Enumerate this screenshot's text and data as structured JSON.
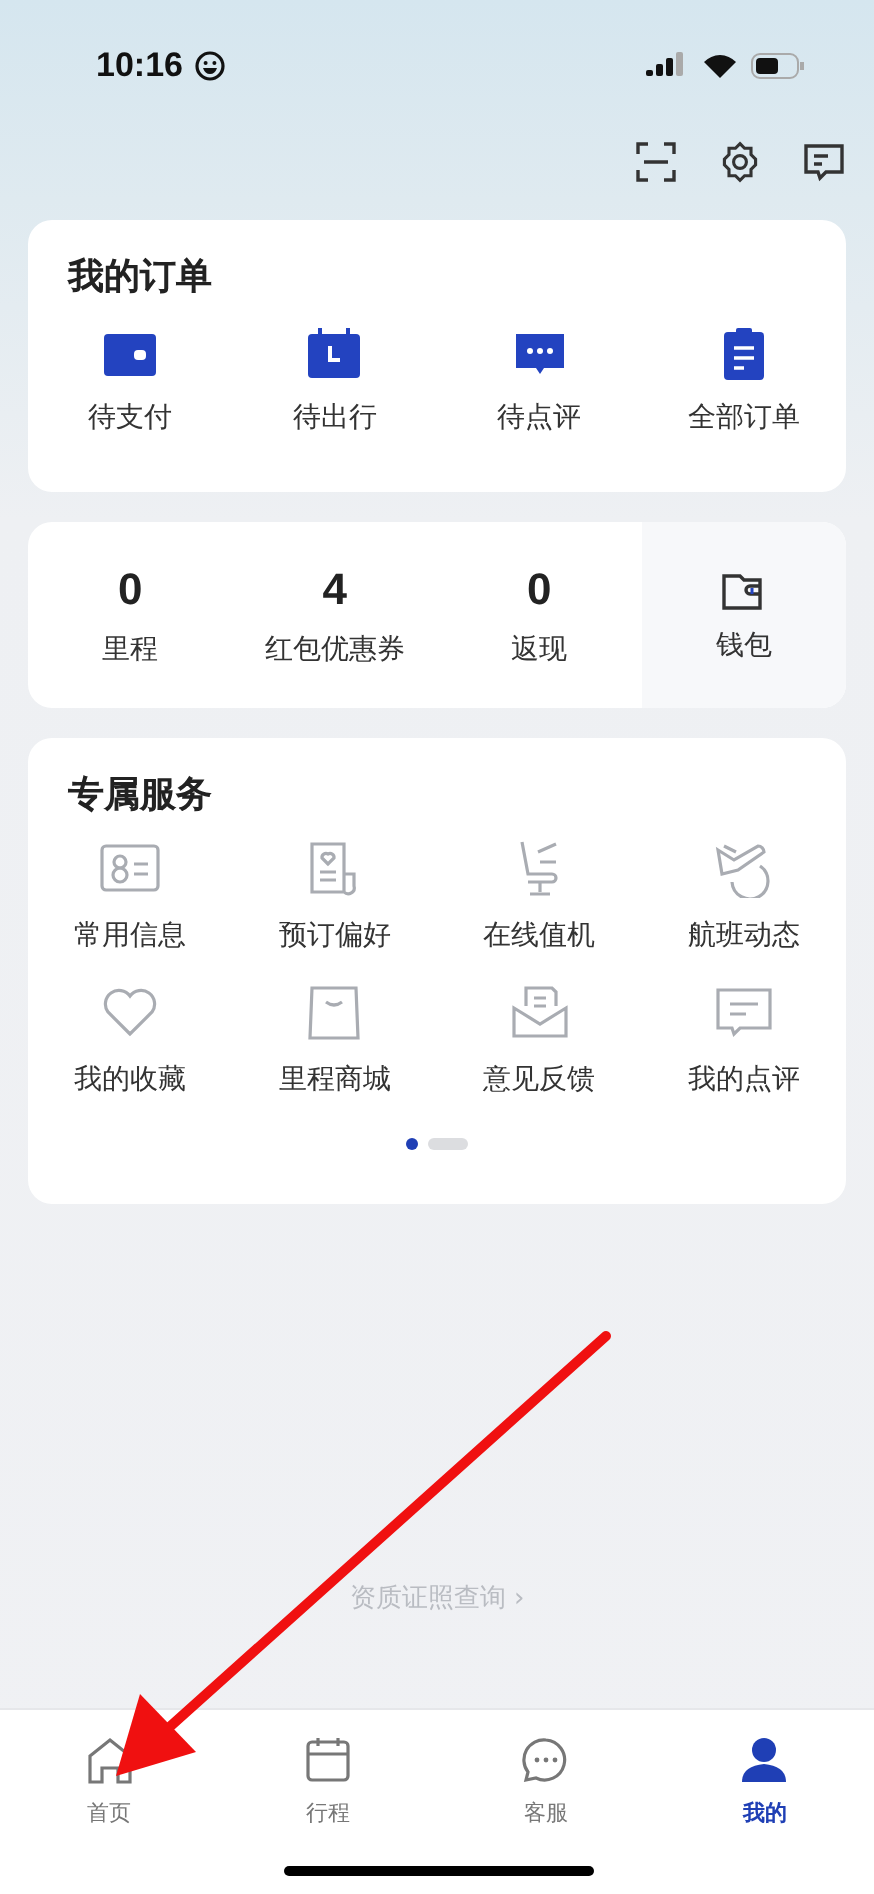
{
  "status_bar": {
    "time": "10:16"
  },
  "orders": {
    "title": "我的订单",
    "items": [
      {
        "label": "待支付",
        "kind": "wallet"
      },
      {
        "label": "待出行",
        "kind": "calendar"
      },
      {
        "label": "待点评",
        "kind": "chat"
      },
      {
        "label": "全部订单",
        "kind": "clipboard"
      }
    ]
  },
  "assets": {
    "items": [
      {
        "value": "0",
        "label": "里程"
      },
      {
        "value": "4",
        "label": "红包优惠券"
      },
      {
        "value": "0",
        "label": "返现"
      }
    ],
    "wallet": {
      "label": "钱包"
    }
  },
  "services": {
    "title": "专属服务",
    "items": [
      {
        "label": "常用信息",
        "kind": "idcard"
      },
      {
        "label": "预订偏好",
        "kind": "doc"
      },
      {
        "label": "在线值机",
        "kind": "seat"
      },
      {
        "label": "航班动态",
        "kind": "plane"
      },
      {
        "label": "我的收藏",
        "kind": "heart"
      },
      {
        "label": "里程商城",
        "kind": "bag"
      },
      {
        "label": "意见反馈",
        "kind": "mail"
      },
      {
        "label": "我的点评",
        "kind": "comment"
      }
    ],
    "pages": [
      {
        "selected": true
      },
      {
        "selected": false
      }
    ]
  },
  "footer_link": "资质证照查询 ›",
  "tabs": [
    {
      "label": "首页",
      "kind": "home",
      "selected": false
    },
    {
      "label": "行程",
      "kind": "calendar",
      "selected": false
    },
    {
      "label": "客服",
      "kind": "chat",
      "selected": false
    },
    {
      "label": "我的",
      "kind": "user",
      "selected": true
    }
  ]
}
